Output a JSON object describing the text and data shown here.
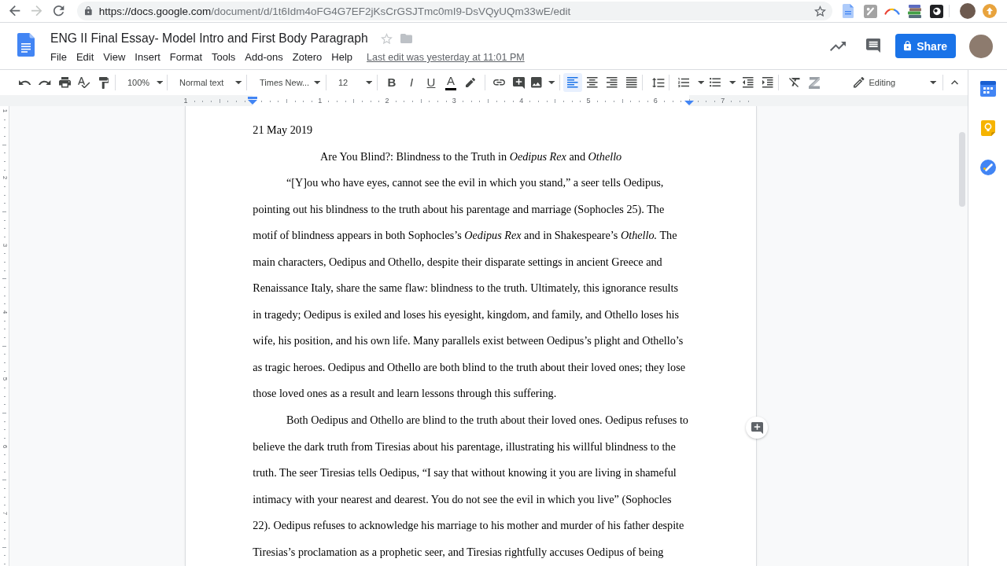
{
  "browser": {
    "back": {
      "disabled": false
    },
    "forward": {
      "disabled": true
    },
    "url": {
      "origin": "https://docs.google.com",
      "path": "/document/d/1t6Idm4oFG4G7EF2jKsCrGSJTmc0mI9-DsVQyUQm33wE/edit"
    }
  },
  "header": {
    "title": "ENG II Final Essay- Model Intro and First Body Paragraph",
    "menu": [
      "File",
      "Edit",
      "View",
      "Insert",
      "Format",
      "Tools",
      "Add-ons",
      "Zotero",
      "Help"
    ],
    "last_edit": "Last edit was yesterday at 11:01 PM",
    "share": "Share"
  },
  "toolbar": {
    "zoom": "100%",
    "paragraph_style": "Normal text",
    "font": "Times New...",
    "font_size": "12",
    "text_styles": [
      {
        "kind": "bold",
        "label": "B"
      },
      {
        "kind": "italic",
        "label": "I"
      },
      {
        "kind": "underline",
        "label": "U"
      },
      {
        "kind": "color",
        "label": "A"
      }
    ],
    "alignment": [
      {
        "kind": "left",
        "selected": true
      },
      {
        "kind": "center",
        "selected": false
      },
      {
        "kind": "right",
        "selected": false
      },
      {
        "kind": "justify",
        "selected": false
      }
    ],
    "mode": "Editing"
  },
  "ruler": {
    "labels": [
      "1",
      "1",
      "2",
      "3",
      "4",
      "5",
      "6",
      "7"
    ]
  },
  "vertical_ruler": {
    "labels": [
      "1",
      "2",
      "3",
      "4",
      "5",
      "6",
      "7"
    ]
  },
  "document": {
    "date": "21 May 2019",
    "title": "Are You Blind?: Blindness to the Truth in *Oedipus Rex* and *Othello*",
    "paragraphs": [
      "“[Y]ou who have eyes, cannot see the evil in which you stand,” a seer tells Oedipus, pointing out his blindness to the truth about his parentage and marriage (Sophocles 25). The motif of blindness appears in both Sophocles’s *Oedipus Rex* and in Shakespeare’s *Othello.* The main characters, Oedipus and Othello, despite their disparate settings in ancient Greece and Renaissance Italy, share the same flaw: blindness to the truth. Ultimately, this ignorance results in tragedy; Oedipus is exiled and loses his eyesight, kingdom, and family, and Othello loses his wife, his position, and his own life. Many parallels exist between Oedipus’s plight and Othello’s as tragic heroes. Oedipus and Othello are both blind to the truth about their loved ones; they lose those loved ones as a result and learn lessons through this suffering.",
      "Both Oedipus and Othello are blind to the truth about their loved ones. Oedipus refuses to believe the dark truth from Tiresias about his parentage, illustrating his willful blindness to the truth. The seer Tiresias tells Oedipus, “I say that without knowing it you are living in shameful intimacy with your nearest and dearest. You do not see the evil in which you live” (Sophocles 22). Oedipus refuses to acknowledge his marriage to his mother and murder of his father despite Tiresias’s proclamation as a prophetic seer, and Tiresias rightfully accuses Oedipus of being"
    ]
  }
}
